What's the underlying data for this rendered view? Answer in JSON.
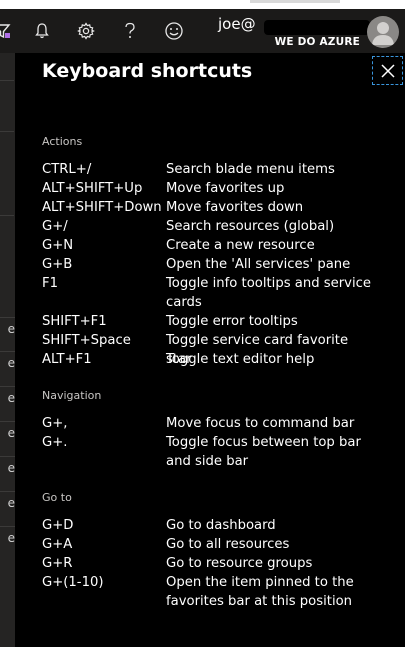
{
  "topbar": {
    "icons": [
      "filter-icon",
      "bell-icon",
      "gear-icon",
      "question-icon",
      "smiley-icon"
    ],
    "user_name": "joe@",
    "directory": "WE DO AZURE"
  },
  "left_panel": {
    "items": [
      "e",
      "e",
      "e",
      "e",
      "e",
      "e",
      "e"
    ]
  },
  "panel": {
    "title": "Keyboard shortcuts",
    "sections": [
      {
        "label": "Actions",
        "rows": [
          {
            "key": "CTRL+/",
            "desc": "Search blade menu items"
          },
          {
            "key": "ALT+SHIFT+Up",
            "desc": "Move favorites up"
          },
          {
            "key": "ALT+SHIFT+Down",
            "desc": "Move favorites down"
          },
          {
            "key": "G+/",
            "desc": "Search resources (global)"
          },
          {
            "key": "G+N",
            "desc": "Create a new resource"
          },
          {
            "key": "G+B",
            "desc": "Open the 'All services' pane"
          },
          {
            "key": "F1",
            "desc": "Toggle info tooltips and service cards"
          },
          {
            "key": "SHIFT+F1",
            "desc": "Toggle error tooltips"
          },
          {
            "key": "SHIFT+Space",
            "desc": "Toggle service card favorite star"
          },
          {
            "key": "ALT+F1",
            "desc": "Toggle text editor help"
          }
        ]
      },
      {
        "label": "Navigation",
        "rows": [
          {
            "key": "G+,",
            "desc": "Move focus to command bar"
          },
          {
            "key": "G+.",
            "desc": "Toggle focus between top bar and side bar"
          }
        ]
      },
      {
        "label": "Go to",
        "rows": [
          {
            "key": "G+D",
            "desc": "Go to dashboard"
          },
          {
            "key": "G+A",
            "desc": "Go to all resources"
          },
          {
            "key": "G+R",
            "desc": "Go to resource groups"
          },
          {
            "key": "G+(1-10)",
            "desc": "Open the item pinned to the favorites bar at this position"
          }
        ]
      }
    ]
  }
}
